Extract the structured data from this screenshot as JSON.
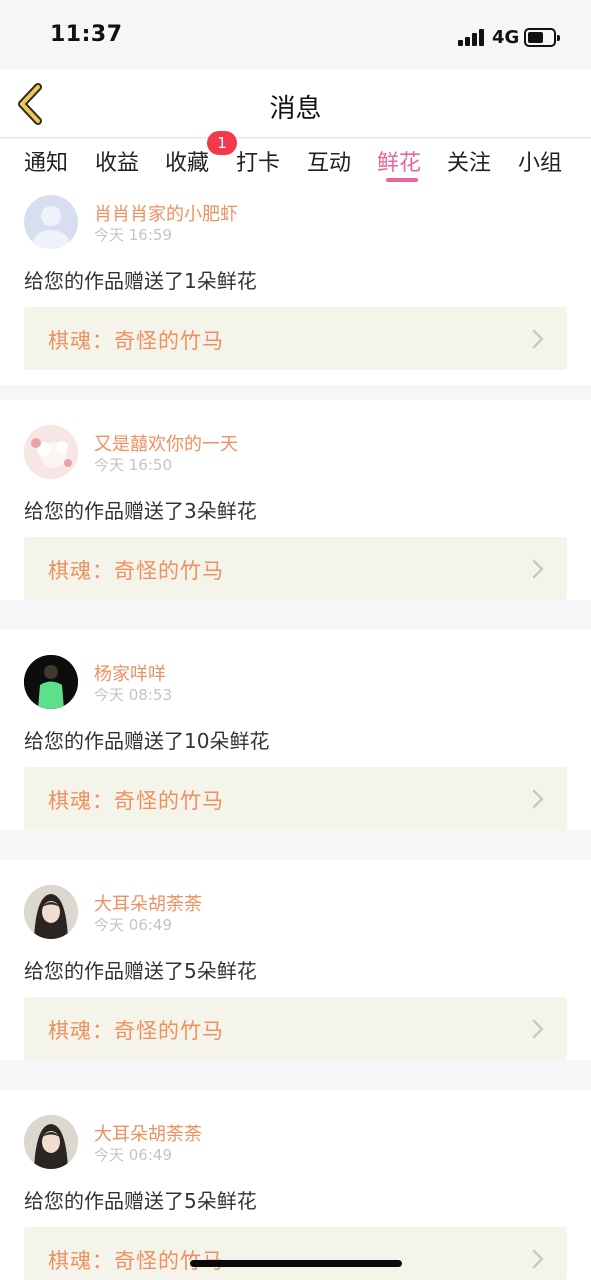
{
  "status": {
    "time": "11:37",
    "network": "4G"
  },
  "nav": {
    "title": "消息",
    "back_icon": "chevron-left-icon",
    "accent": "#f2c94c"
  },
  "tabs": [
    {
      "label": "通知"
    },
    {
      "label": "收益"
    },
    {
      "label": "收藏",
      "badge": "1"
    },
    {
      "label": "打卡"
    },
    {
      "label": "互动"
    },
    {
      "label": "鲜花",
      "active": true
    },
    {
      "label": "关注"
    },
    {
      "label": "小组"
    }
  ],
  "colors": {
    "active_tab": "#e8659b",
    "username": "#ee9160",
    "badge": "#f2394d",
    "work_bg": "#f4f4ea"
  },
  "messages": [
    {
      "user": "肖肖肖家的小肥虾",
      "time": "今天 16:59",
      "text": "给您的作品赠送了1朵鲜花",
      "work": "棋魂：奇怪的竹马"
    },
    {
      "user": "又是囍欢你的一天",
      "time": "今天 16:50",
      "text": "给您的作品赠送了3朵鲜花",
      "work": "棋魂：奇怪的竹马"
    },
    {
      "user": "杨家咩咩",
      "time": "今天 08:53",
      "text": "给您的作品赠送了10朵鲜花",
      "work": "棋魂：奇怪的竹马"
    },
    {
      "user": "大耳朵胡荼荼",
      "time": "今天 06:49",
      "text": "给您的作品赠送了5朵鲜花",
      "work": "棋魂：奇怪的竹马"
    },
    {
      "user": "大耳朵胡荼荼",
      "time": "今天 06:49",
      "text": "给您的作品赠送了5朵鲜花",
      "work": "棋魂：奇怪的竹马"
    }
  ]
}
